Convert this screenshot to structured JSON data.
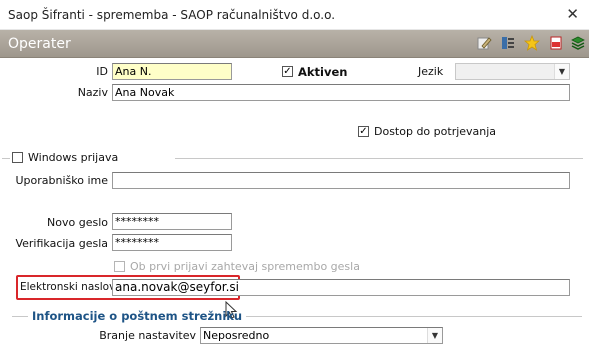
{
  "window": {
    "title": "Saop Šifranti - sprememba - SAOP računalništvo d.o.o.",
    "close": "✕"
  },
  "header": {
    "title": "Operater",
    "tool_icons": [
      "edit-icon",
      "list-icon",
      "star-icon",
      "pdf-icon",
      "book-icon"
    ]
  },
  "form": {
    "id": {
      "label": "ID",
      "value": "Ana N."
    },
    "aktiven": {
      "label": "Aktiven",
      "checked": true,
      "mark": "✓"
    },
    "jezik": {
      "label": "Jezik",
      "value": ""
    },
    "naziv": {
      "label": "Naziv",
      "value": "Ana Novak"
    },
    "dostop": {
      "label": "Dostop do potrjevanja",
      "checked": true,
      "mark": "✓"
    },
    "windows_prijava": {
      "label": "Windows prijava",
      "checked": false
    },
    "uporabnisko_ime": {
      "label": "Uporabniško ime",
      "value": ""
    },
    "novo_geslo": {
      "label": "Novo geslo",
      "value": "********"
    },
    "verifikacija_gesla": {
      "label": "Verifikacija gesla",
      "value": "********"
    },
    "zahtevaj": {
      "label": "Ob prvi prijavi zahtevaj spremembo gesla",
      "checked": false
    },
    "elektronski_naslov": {
      "label": "Elektronski naslov",
      "value": "ana.novak@seyfor.si"
    },
    "informacije": {
      "label": "Informacije o poštnem strežniku"
    },
    "branje_nastavitev": {
      "label": "Branje nastavitev",
      "value": "Neposredno"
    }
  },
  "colors": {
    "accent_title": "#1e5486",
    "highlight": "#d9262a",
    "id_field_bg": "#ffffc8",
    "header_bg": "#a79f94"
  }
}
